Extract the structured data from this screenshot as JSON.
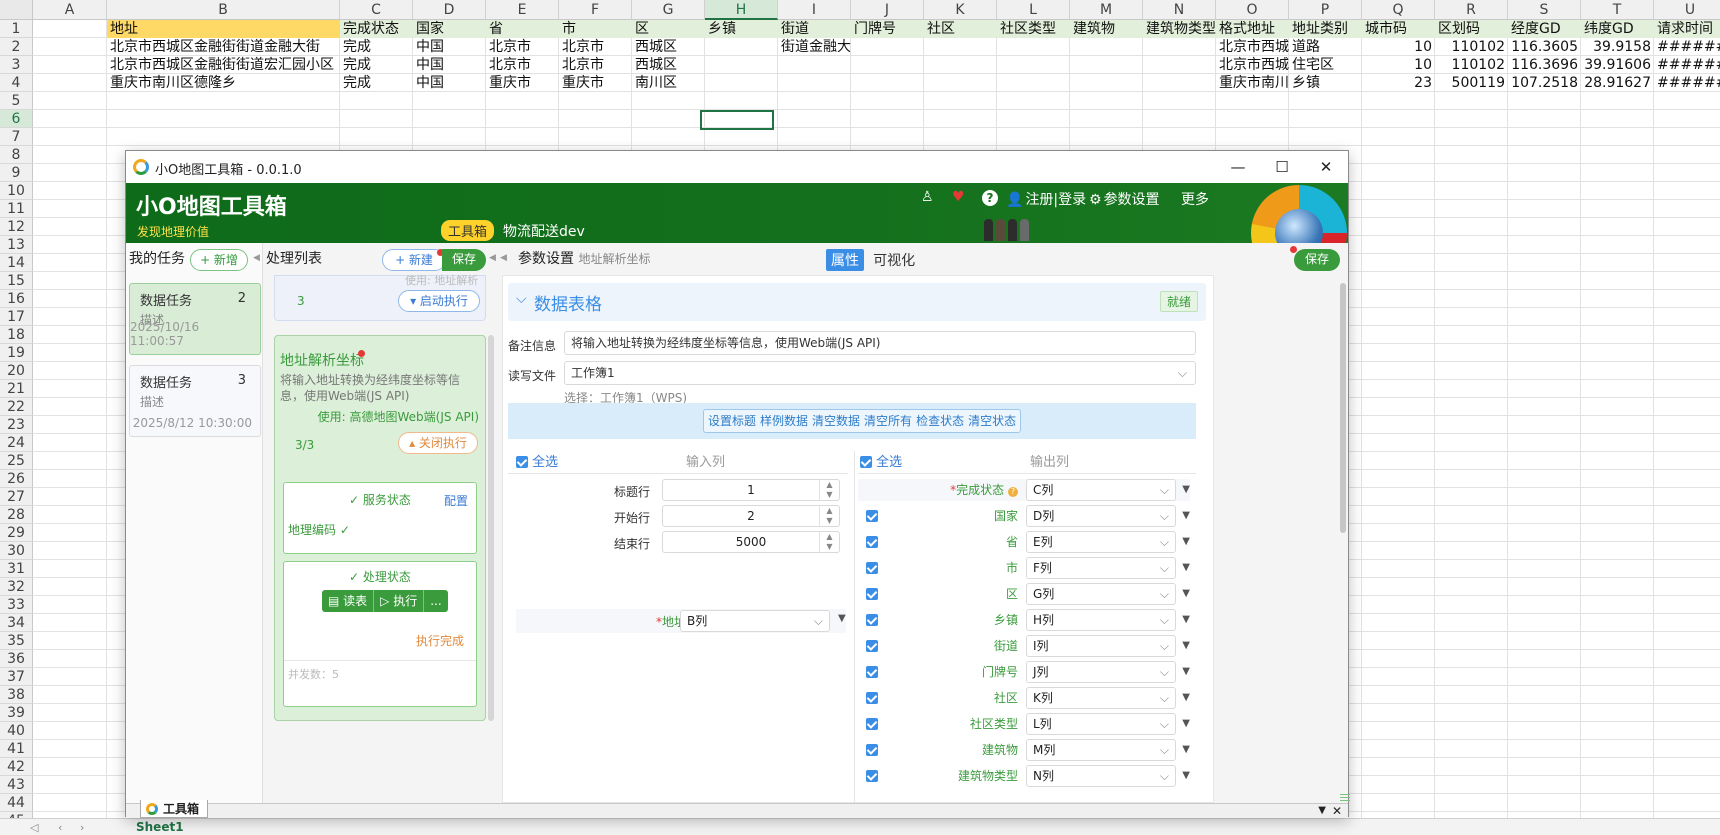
{
  "sheet": {
    "columns": [
      "A",
      "B",
      "C",
      "D",
      "E",
      "F",
      "G",
      "H",
      "I",
      "J",
      "K",
      "L",
      "M",
      "N",
      "O",
      "P",
      "Q",
      "R",
      "S",
      "T",
      "U"
    ],
    "rows": [
      "1",
      "2",
      "3",
      "4",
      "5",
      "6",
      "7",
      "8",
      "9",
      "10",
      "11",
      "12",
      "13",
      "14",
      "15",
      "16",
      "17",
      "18",
      "19",
      "20",
      "21",
      "22",
      "23",
      "24",
      "25",
      "26",
      "27",
      "28",
      "29",
      "30",
      "31",
      "32",
      "33",
      "34",
      "35",
      "36",
      "37",
      "38",
      "39",
      "40",
      "41",
      "42",
      "43",
      "44",
      "45"
    ],
    "header_row": [
      "",
      "地址",
      "完成状态",
      "国家",
      "省",
      "市",
      "区",
      "乡镇",
      "街道",
      "门牌号",
      "社区",
      "社区类型",
      "建筑物",
      "建筑物类型",
      "格式地址",
      "地址类别",
      "城市码",
      "区划码",
      "经度GD",
      "纬度GD",
      "请求时间"
    ],
    "data_rows": [
      [
        "",
        "北京市西城区金融街街道金融大街",
        "完成",
        "中国",
        "北京市",
        "北京市",
        "西城区",
        "",
        "街道金融大街",
        "",
        "",
        "",
        "",
        "",
        "北京市西城",
        "道路",
        "10",
        "110102",
        "116.3605",
        "39.9158",
        "########"
      ],
      [
        "",
        "北京市西城区金融街街道宏汇园小区",
        "完成",
        "中国",
        "北京市",
        "北京市",
        "西城区",
        "",
        "",
        "",
        "",
        "",
        "",
        "",
        "北京市西城",
        "住宅区",
        "10",
        "110102",
        "116.3696",
        "39.91606",
        "########"
      ],
      [
        "",
        "重庆市南川区德隆乡",
        "完成",
        "中国",
        "重庆市",
        "重庆市",
        "南川区",
        "",
        "",
        "",
        "",
        "",
        "",
        "",
        "重庆市南川",
        "乡镇",
        "23",
        "500119",
        "107.2518",
        "28.91627",
        "########"
      ]
    ],
    "selected_cell": "H6",
    "sheet_tab": "Sheet1"
  },
  "window": {
    "title": "小O地图工具箱 - 0.0.1.0",
    "brand": "小O地图工具箱",
    "slogan": "发现地理价值",
    "badge": "工具箱",
    "project": "物流配送dev",
    "menu": {
      "register": "注册|登录",
      "settings": "参数设置",
      "more": "更多"
    }
  },
  "tasks": {
    "title": "我的任务",
    "new_label": "+ 新增",
    "items": [
      {
        "name": "数据任务",
        "count": "2",
        "desc": "描述",
        "date": "2025/10/16 11:00:57"
      },
      {
        "name": "数据任务",
        "count": "3",
        "desc": "描述",
        "date": "2025/8/12 10:30:00"
      }
    ]
  },
  "processing": {
    "title": "处理列表",
    "new_label": "+ 新建",
    "save_label": "保存",
    "prev_card": {
      "count": "3",
      "faded": "使用: 地址解析",
      "start_label": "启动执行"
    },
    "card": {
      "title": "地址解析坐标",
      "desc": "将输入地址转换为经纬度坐标等信息，使用Web端(JS API)",
      "use": "使用: 高德地图Web端(JS API)",
      "progress": "3/3",
      "close_label": "关闭执行",
      "service_title": "服务状态",
      "config_label": "配置",
      "service_item": "地理编码 ✓",
      "proc_title": "处理状态",
      "read_label": "读表",
      "exec_label": "执行",
      "more_label": "...",
      "done_label": "执行完成",
      "concurrency": "并发数：5"
    }
  },
  "params": {
    "title": "参数设置",
    "subtitle": "地址解析坐标",
    "tab_attr": "属性",
    "tab_vis": "可视化",
    "save_label": "保存",
    "section_title": "数据表格",
    "status": "就绪",
    "note_label": "备注信息",
    "note_value": "将输入地址转换为经纬度坐标等信息，使用Web端(JS API)",
    "file_label": "读写文件",
    "file_value": "工作簿1",
    "file_hint": "选择：工作簿1（WPS)",
    "toolbar": [
      "设置标题",
      "样例数据",
      "清空数据",
      "清空所有",
      "检查状态",
      "清空状态"
    ],
    "select_all": "全选",
    "input_col_title": "输入列",
    "output_col_title": "输出列",
    "inputs": [
      {
        "label": "标题行",
        "value": "1"
      },
      {
        "label": "开始行",
        "value": "2"
      },
      {
        "label": "结束行",
        "value": "5000"
      }
    ],
    "address": {
      "label": "地址",
      "value": "B列"
    },
    "outputs": [
      {
        "label": "完成状态",
        "value": "C列"
      },
      {
        "label": "国家",
        "value": "D列"
      },
      {
        "label": "省",
        "value": "E列"
      },
      {
        "label": "市",
        "value": "F列"
      },
      {
        "label": "区",
        "value": "G列"
      },
      {
        "label": "乡镇",
        "value": "H列"
      },
      {
        "label": "街道",
        "value": "I列"
      },
      {
        "label": "门牌号",
        "value": "J列"
      },
      {
        "label": "社区",
        "value": "K列"
      },
      {
        "label": "社区类型",
        "value": "L列"
      },
      {
        "label": "建筑物",
        "value": "M列"
      },
      {
        "label": "建筑物类型",
        "value": "N列"
      }
    ]
  },
  "bottom_tab": "工具箱"
}
